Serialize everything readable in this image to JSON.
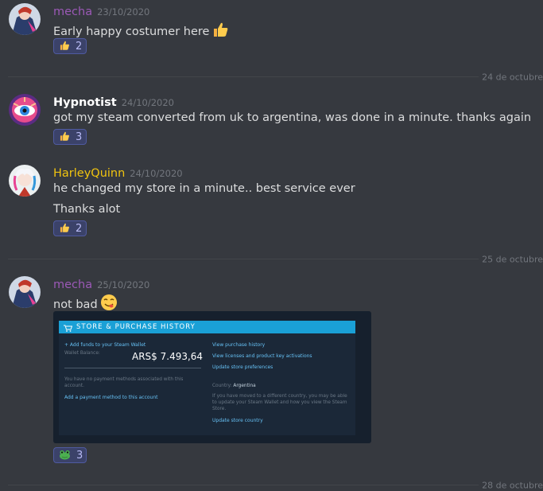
{
  "messages": [
    {
      "username": "mecha",
      "timestamp": "23/10/2020",
      "lines": [
        "Early happy costumer here"
      ],
      "reaction": {
        "emoji": "thumbs-up",
        "count": "2"
      }
    },
    {
      "username": "Hypnotist",
      "timestamp": "24/10/2020",
      "lines": [
        "got my steam converted from uk to argentina, was done in a minute. thanks again"
      ],
      "reaction": {
        "emoji": "thumbs-up",
        "count": "3"
      }
    },
    {
      "username": "HarleyQuinn",
      "timestamp": "24/10/2020",
      "lines": [
        "he changed my store in a minute.. best service ever",
        "Thanks alot"
      ],
      "reaction": {
        "emoji": "thumbs-up",
        "count": "2"
      }
    },
    {
      "username": "mecha",
      "timestamp": "25/10/2020",
      "lines": [
        "not bad"
      ],
      "reaction": {
        "emoji": "frog",
        "count": "3"
      }
    }
  ],
  "dividers": [
    "24 de octubre",
    "25 de octubre",
    "28 de octubre"
  ],
  "steam_embed": {
    "header": "STORE & PURCHASE HISTORY",
    "add_funds": "+ Add funds to your Steam Wallet",
    "wallet_label": "Wallet Balance:",
    "wallet_balance": "ARS$ 7.493,64",
    "no_payment": "You have no payment methods associated with this account.",
    "add_payment": "Add a payment method to this account",
    "view_history": "View purchase history",
    "view_licenses": "View licenses and product key activations",
    "update_prefs": "Update store preferences",
    "country_label": "Country:",
    "country_value": "Argentina",
    "moved_note": "If you have moved to a different country, you may be able to update your Steam Wallet and how you view the Steam Store.",
    "update_country": "Update store country"
  },
  "colors": {
    "background": "#36393f",
    "mecha": "#9b59b6",
    "hypnotist": "#ffffff",
    "harley": "#f1c40f",
    "reaction_bg": "#3b4269",
    "steam_blue": "#1aa0d6",
    "steam_link": "#66c0f4"
  }
}
